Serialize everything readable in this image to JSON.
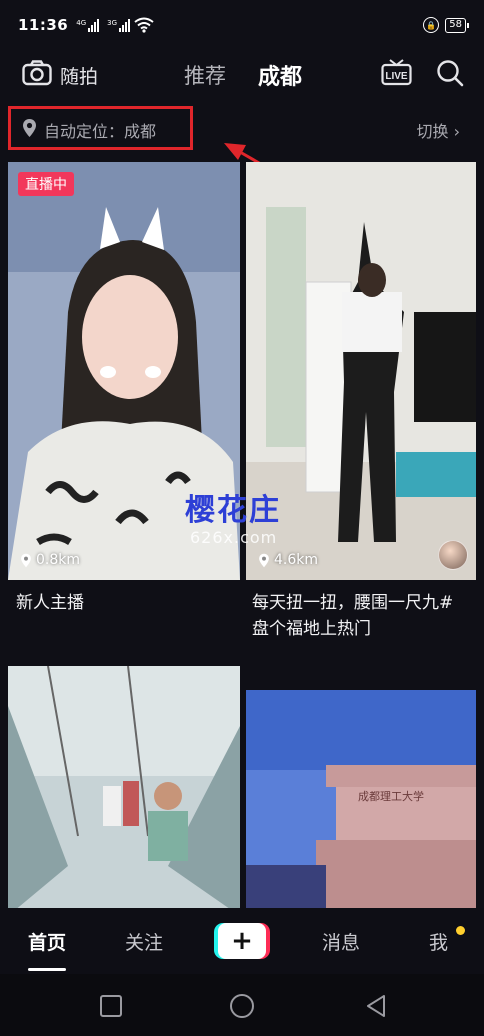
{
  "status_bar": {
    "time": "11:36",
    "signal1": "4G",
    "signal2": "3G",
    "battery": "58"
  },
  "top_nav": {
    "camera_label": "随拍",
    "tab_recommend": "推荐",
    "tab_city": "成都",
    "live_icon": "live-icon",
    "search_icon": "search-icon"
  },
  "location": {
    "text": "自动定位：成都",
    "switch_label": "切换 ›"
  },
  "feed": [
    {
      "badge": "直播中",
      "distance": "0.8km",
      "caption": "新人主播"
    },
    {
      "distance": "4.6km",
      "caption_line1": "每天扭一扭，腰围一尺九#",
      "caption_line2": "盘个福地上热门"
    },
    {},
    {
      "sign_text": "成都理工大学"
    }
  ],
  "watermark": {
    "text": "樱花庄",
    "url": "626x.com"
  },
  "tab_bar": {
    "home": "首页",
    "follow": "关注",
    "create": "+",
    "messages": "消息",
    "me": "我"
  },
  "colors": {
    "highlight": "#e0262b",
    "live_badge": "#f2375b",
    "accent_cyan": "#25f4ee",
    "accent_red": "#fe2c55",
    "notify_dot": "#ffcf2e"
  }
}
